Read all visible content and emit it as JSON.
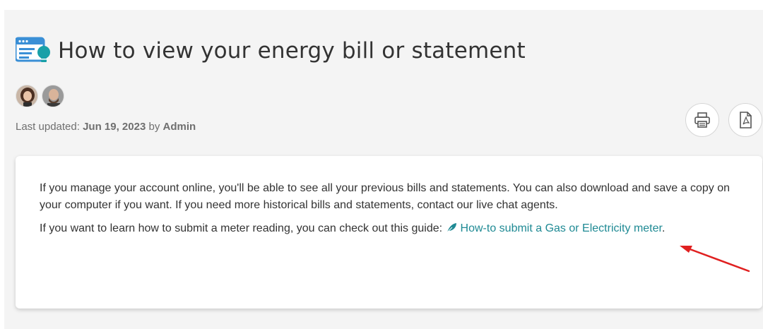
{
  "article": {
    "title": "How to view your energy bill or statement",
    "meta": {
      "prefix": "Last updated: ",
      "date": "Jun 19, 2023",
      "by": " by ",
      "author": "Admin"
    },
    "paragraph1": "If you manage your account online, you'll be able to see all your previous bills and statements. You can also download and save a copy on your computer if you want. If you need more historical bills and statements, contact our live chat agents.",
    "paragraph2_prefix": "If you want to learn how to submit a meter reading, you can check out this guide: ",
    "guide_link": "How-to submit a Gas or Electricity meter",
    "paragraph2_suffix": "."
  },
  "toolbar": {
    "print_icon": "printer-icon",
    "pdf_icon": "pdf-icon"
  },
  "colors": {
    "link": "#1f8a94",
    "title_icon_blue": "#3a8fd6",
    "title_icon_teal": "#19a0a8",
    "annotation_arrow": "#e02020"
  }
}
